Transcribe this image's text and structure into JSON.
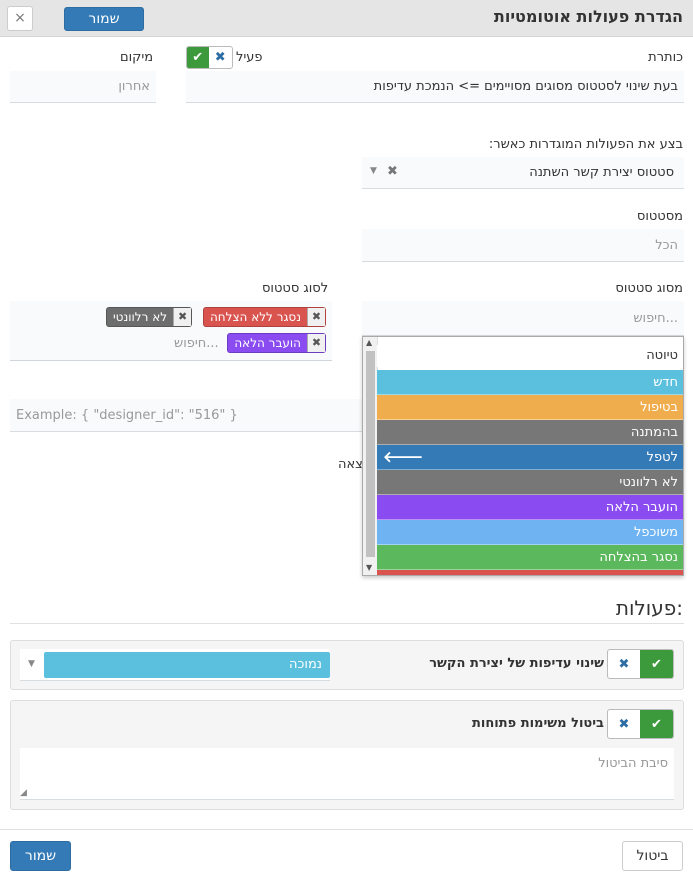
{
  "dialog": {
    "title": "הגדרת פעולות אוטומטיות",
    "save_label": "שמור",
    "close_glyph": "×"
  },
  "form": {
    "title_label": "כותרת",
    "title_value": "בעת שינוי לסטטוס מסוגים מסויימים => הנמכת עדיפות",
    "active_label": "פעיל",
    "position_label": "מיקום",
    "position_placeholder": "אחרון",
    "trigger_label": "בצע את הפעולות המוגדרות כאשר:",
    "trigger_value": "סטטוס יצירת קשר השתנה",
    "from_status_label": "מסטטוס",
    "from_status_placeholder": "הכל",
    "from_status_type_label": "מסוג סטטוס",
    "search_placeholder": "חיפוש...",
    "to_status_type_label": "לסוג סטטוס",
    "to_tags": [
      {
        "label": "נסגר ללא הצלחה",
        "color": "#d9534f"
      },
      {
        "label": "לא רלוונטי",
        "color": "#6d6d6d"
      },
      {
        "label": "הועבר הלאה",
        "color": "#8a4cf0"
      }
    ],
    "condition_placeholder": "Example: { \"designer_id\": \"516\" }",
    "condition_label_partial": "צאה"
  },
  "dropdown": {
    "items": [
      {
        "label": "טיוטה",
        "color": "#ffffff",
        "text_color": "#333333"
      },
      {
        "label": "חדש",
        "color": "#5bc0de"
      },
      {
        "label": "בטיפול",
        "color": "#f0ad4e"
      },
      {
        "label": "בהמתנה",
        "color": "#777777"
      },
      {
        "label": "לטפל",
        "color": "#337ab7",
        "icon": "arrow-left-icon"
      },
      {
        "label": "לא רלוונטי",
        "color": "#777777"
      },
      {
        "label": "הועבר הלאה",
        "color": "#8a4cf0"
      },
      {
        "label": "משוכפל",
        "color": "#6fb3f2"
      },
      {
        "label": "נסגר בהצלחה",
        "color": "#5cb85c"
      }
    ]
  },
  "actions": {
    "section_title": "פעולות:",
    "priority": {
      "label": "שינוי עדיפות של יצירת הקשר",
      "value": "נמוכה",
      "value_color": "#5bc0de"
    },
    "cancel_tasks": {
      "label": "ביטול משימות פתוחות",
      "reason_placeholder": "סיבת הביטול"
    }
  },
  "footer": {
    "cancel_label": "ביטול",
    "save_label": "שמור"
  }
}
